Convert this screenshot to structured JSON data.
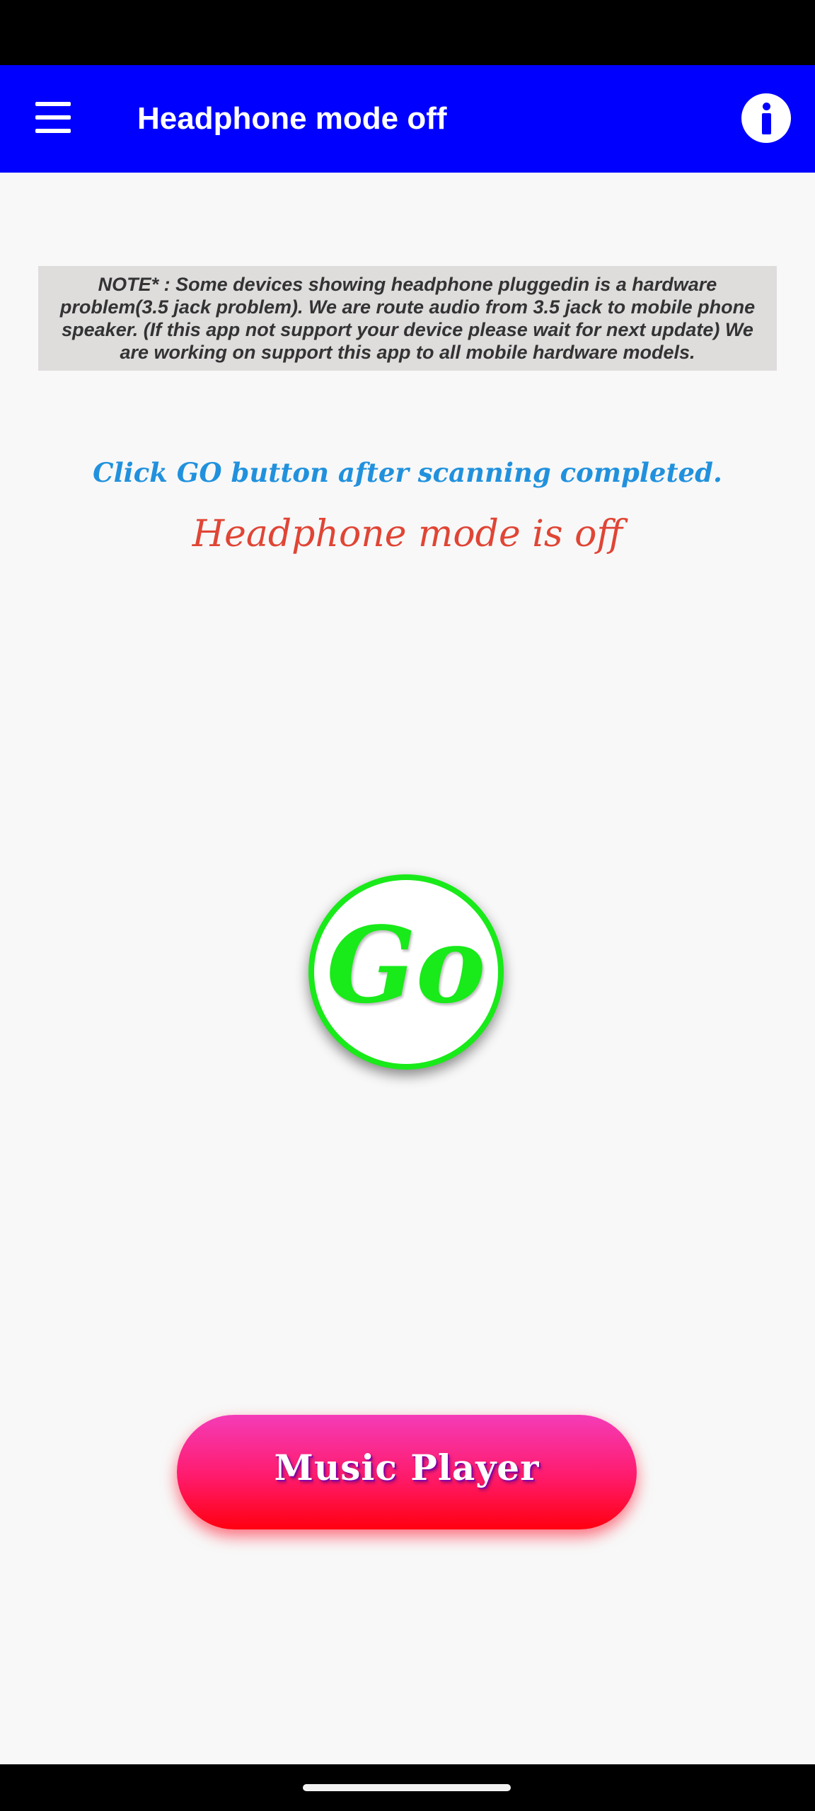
{
  "app_bar": {
    "title": "Headphone mode off",
    "menu_icon": "hamburger-menu-icon",
    "info_icon": "info-icon",
    "color": "#0000ff"
  },
  "note": {
    "text": "NOTE* : Some devices showing headphone pluggedin is a hardware problem(3.5 jack problem). We are route audio from 3.5 jack to mobile phone speaker. (If this app not support your device please wait for next update) We are working on support this app to all mobile hardware models."
  },
  "main": {
    "instruction": "Click GO button after scanning completed.",
    "status": "Headphone mode is off",
    "go_label": "Go",
    "music_player_label": "Music Player"
  },
  "colors": {
    "instruction": "#2191dd",
    "status": "#e04535",
    "go_green": "#19ea19",
    "music_pink": "#f43cb8",
    "music_red": "#ff0010"
  }
}
